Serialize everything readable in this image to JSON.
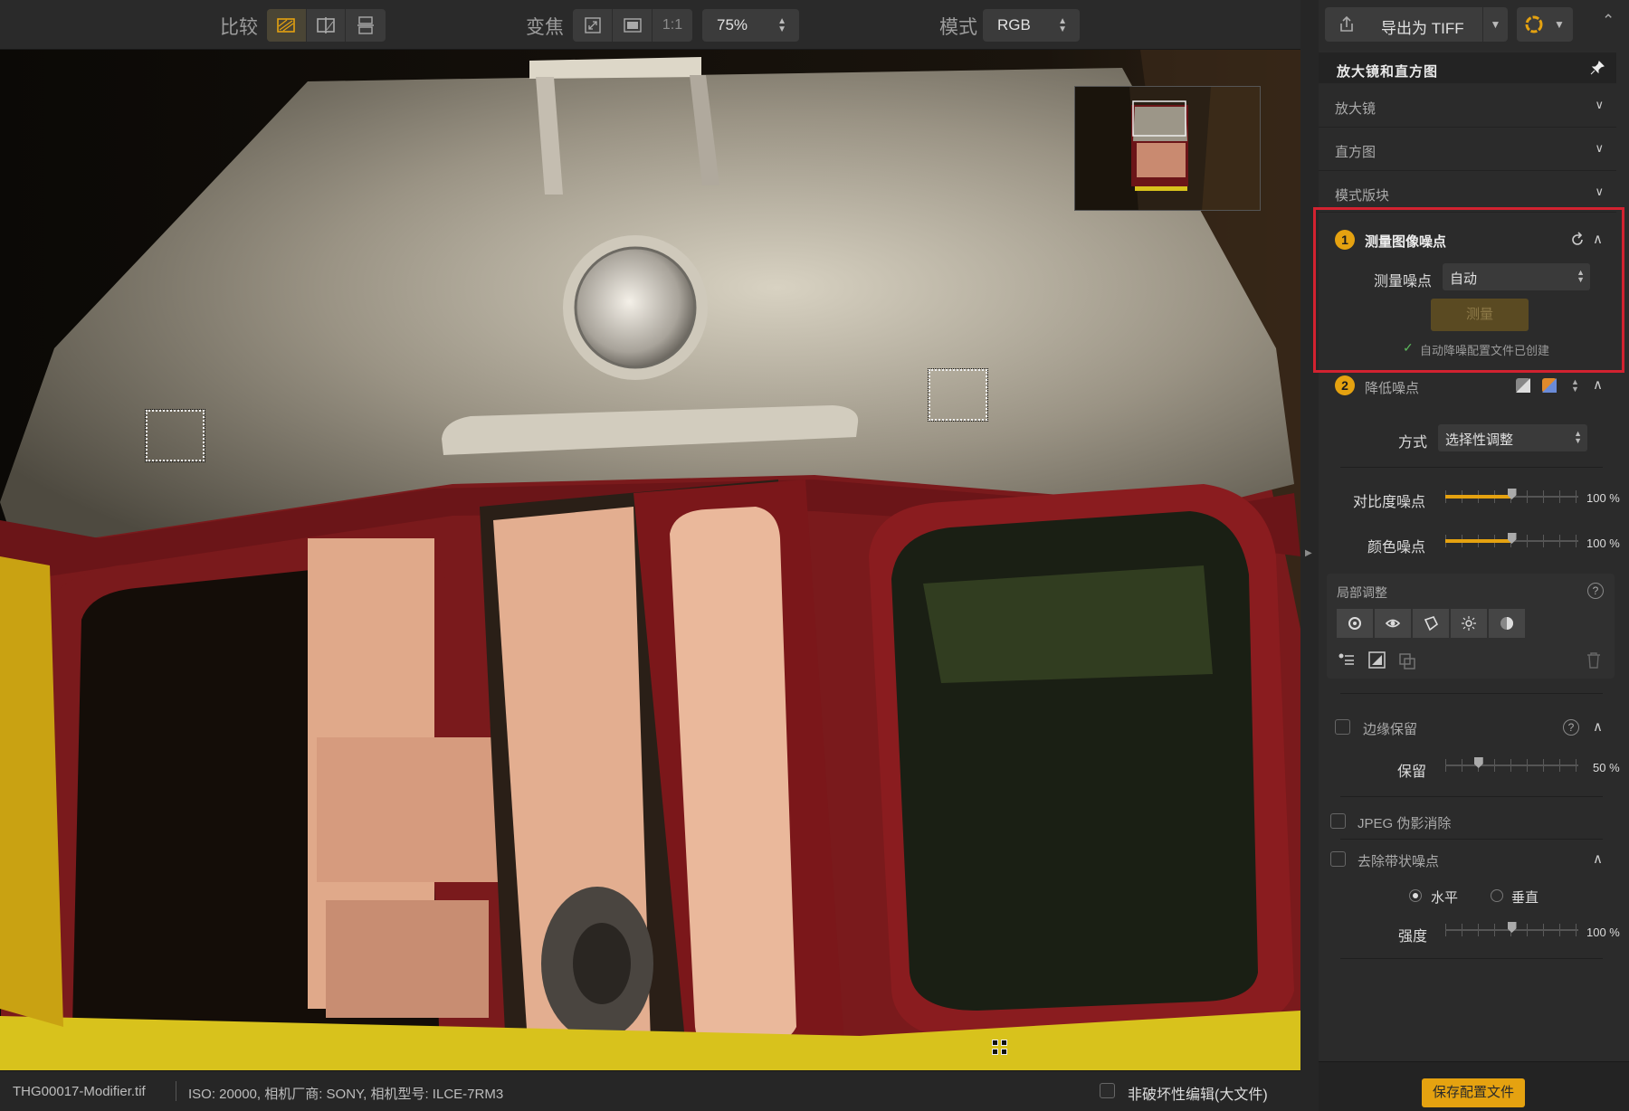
{
  "toolbar": {
    "compare_label": "比较",
    "zoom_label": "变焦",
    "zoom_1to1": "1:1",
    "zoom_value": "75%",
    "mode_label": "模式",
    "mode_value": "RGB",
    "export_label": "导出为 TIFF"
  },
  "panel": {
    "title": "放大镜和直方图",
    "sections": [
      "放大镜",
      "直方图",
      "模式版块"
    ],
    "step1": {
      "num": "1",
      "title": "测量图像噪点",
      "field_label": "测量噪点",
      "field_value": "自动",
      "button": "测量",
      "status": "自动降噪配置文件已创建"
    },
    "step2": {
      "num": "2",
      "title": "降低噪点",
      "method_label": "方式",
      "method_value": "选择性调整",
      "sliders": [
        {
          "label": "对比度噪点",
          "value": 100,
          "pct": "100 %"
        },
        {
          "label": "颜色噪点",
          "value": 100,
          "pct": "100 %"
        }
      ]
    },
    "local": {
      "title": "局部调整",
      "help": "?"
    },
    "edge": {
      "title": "边缘保留",
      "help": "?",
      "slider_label": "保留",
      "value": 50,
      "pct": "50 %"
    },
    "jpeg": {
      "title": "JPEG 伪影消除"
    },
    "banding": {
      "title": "去除带状噪点",
      "opt_h": "水平",
      "opt_v": "垂直",
      "slider_label": "强度",
      "value": 100,
      "pct": "100 %"
    },
    "save_button": "保存配置文件"
  },
  "status": {
    "filename": "THG00017-Modifier.tif",
    "meta": "ISO: 20000, 相机厂商: SONY, 相机型号: ILCE-7RM3",
    "nondestructive_label": "非破坏性编辑(大文件)"
  },
  "colors": {
    "accent": "#e5a210",
    "highlight": "#d22230"
  }
}
